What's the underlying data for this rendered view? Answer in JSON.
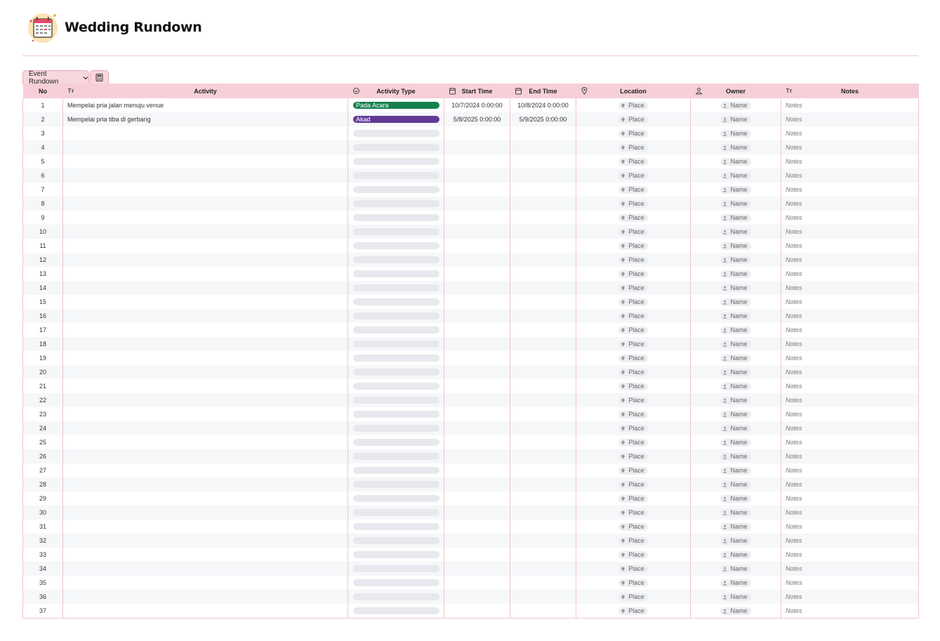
{
  "page": {
    "title": "Wedding Rundown"
  },
  "tabs": {
    "active_label": "Event Rundown",
    "icon": "calculator-icon"
  },
  "columns": {
    "no": "No",
    "activity": "Activity",
    "activity_type": "Activity Type",
    "start_time": "Start Time",
    "end_time": "End Time",
    "location": "Location",
    "owner": "Owner",
    "notes": "Notes"
  },
  "column_icons": {
    "activity": "Tт",
    "notes": "Tт"
  },
  "placeholders": {
    "location": "Place",
    "owner": "Name",
    "notes": "Notes"
  },
  "colors": {
    "accent": "#f6cfd8",
    "border": "#efc6ce",
    "pada_acara": "#15804e",
    "akad": "#623a94"
  },
  "rows": [
    {
      "no": "1",
      "activity": "Mempelai pria jalan menuju venue",
      "type": "Pada Acara",
      "type_color": "green",
      "start": "10/7/2024 0:00:00",
      "end": "10/8/2024 0:00:00"
    },
    {
      "no": "2",
      "activity": "Mempelai pria tiba di gerbang",
      "type": "Akad",
      "type_color": "purple",
      "start": "5/8/2025 0:00:00",
      "end": "5/9/2025 0:00:00"
    },
    {
      "no": "3"
    },
    {
      "no": "4"
    },
    {
      "no": "5"
    },
    {
      "no": "6"
    },
    {
      "no": "7"
    },
    {
      "no": "8"
    },
    {
      "no": "9"
    },
    {
      "no": "10"
    },
    {
      "no": "11"
    },
    {
      "no": "12"
    },
    {
      "no": "13"
    },
    {
      "no": "14"
    },
    {
      "no": "15"
    },
    {
      "no": "16"
    },
    {
      "no": "17"
    },
    {
      "no": "18"
    },
    {
      "no": "19"
    },
    {
      "no": "20"
    },
    {
      "no": "21"
    },
    {
      "no": "22"
    },
    {
      "no": "23"
    },
    {
      "no": "24"
    },
    {
      "no": "25"
    },
    {
      "no": "26"
    },
    {
      "no": "27"
    },
    {
      "no": "28"
    },
    {
      "no": "29"
    },
    {
      "no": "30"
    },
    {
      "no": "31"
    },
    {
      "no": "32"
    },
    {
      "no": "33"
    },
    {
      "no": "34"
    },
    {
      "no": "35"
    },
    {
      "no": "36"
    },
    {
      "no": "37"
    }
  ]
}
